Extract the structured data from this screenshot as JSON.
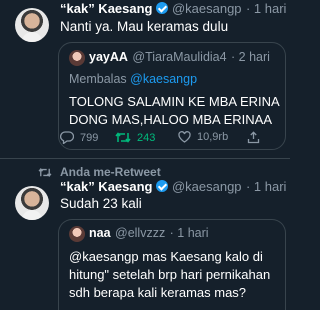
{
  "tweet1": {
    "display_name": "“kak” Kaesang",
    "handle": "@kaesangp",
    "time": "· 1 hari",
    "text": "Nanti ya. Mau keramas dulu",
    "quote": {
      "display_name": "yayAA",
      "handle": "@TiaraMaulidia4",
      "time": "· 2 hari",
      "reply_prefix": "Membalas ",
      "reply_to": "@kaesangp",
      "line1": "TOLONG SALAMIN KE MBA ERINA",
      "line2": "DONG MAS,HALOO MBA ERINAA"
    },
    "actions": {
      "reply_count": "799",
      "retweet_count": "243",
      "like_count": "10,9rb",
      "icons": [
        "comment-icon",
        "retweet-icon",
        "like-icon",
        "share-icon"
      ]
    }
  },
  "retweet_banner": "Anda me-Retweet",
  "tweet2": {
    "display_name": "“kak” Kaesang",
    "handle": "@kaesangp",
    "time": "· 1 hari",
    "text": "Sudah 23 kali",
    "quote": {
      "display_name": "naa",
      "handle": "@ellvzzz",
      "time": "· 1 hari",
      "line1": "@kaesangp mas Kaesang kalo di",
      "line2": "hitung\" setelah brp hari pernikahan",
      "line3": "sdh berapa kali keramas mas?"
    }
  },
  "colors": {
    "background": "#15202b",
    "accent": "#1d9bf0",
    "retweet_green": "#00ba7c",
    "muted": "#8b98a5",
    "border": "#38444d"
  }
}
